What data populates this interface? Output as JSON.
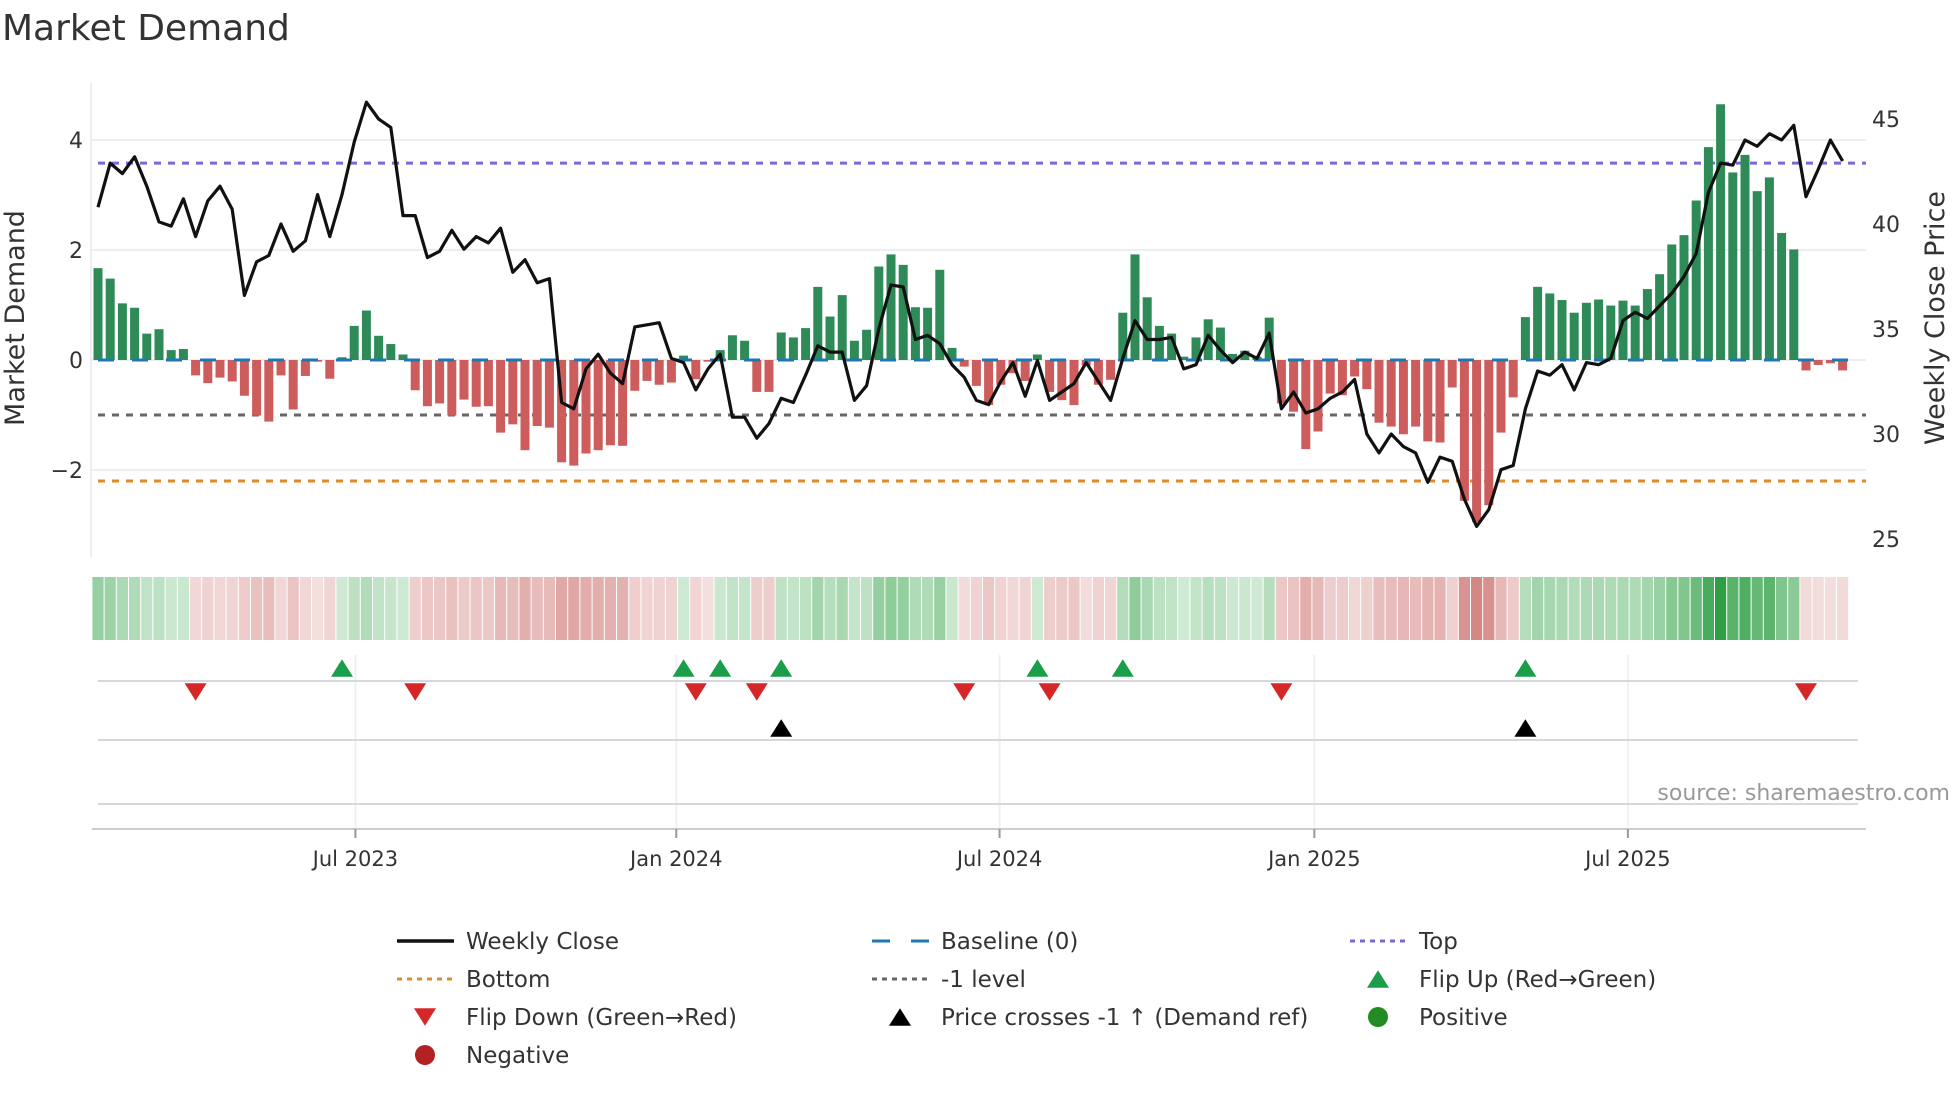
{
  "chart_data": {
    "type": "bar+line",
    "title": "Market Demand",
    "ylabel": "Market Demand",
    "y2label": "Weekly Close Price",
    "ylim": [
      -3.6,
      5.0
    ],
    "y2lim": [
      24.3,
      46.8
    ],
    "yticks": [
      4,
      2,
      0,
      -2
    ],
    "ytick_labels": [
      "4",
      "2",
      "0",
      "−2"
    ],
    "y2ticks": [
      45,
      40,
      35,
      30,
      25
    ],
    "y2tick_labels": [
      "45",
      "40",
      "35",
      "30",
      "25"
    ],
    "xticks": [
      {
        "label": "Jul 2023",
        "week_index": 21.1
      },
      {
        "label": "Jan 2024",
        "week_index": 47.4
      },
      {
        "label": "Jul 2024",
        "week_index": 73.9
      },
      {
        "label": "Jan 2025",
        "week_index": 99.7
      },
      {
        "label": "Jul 2025",
        "week_index": 125.4
      }
    ],
    "levels": {
      "top": 3.58,
      "bottom": -2.2,
      "minus_one": -1.0,
      "baseline": 0
    },
    "demand": [
      1.67,
      1.48,
      1.03,
      0.95,
      0.48,
      0.56,
      0.18,
      0.2,
      -0.28,
      -0.42,
      -0.32,
      -0.39,
      -0.65,
      -1.01,
      -1.12,
      -0.28,
      -0.9,
      -0.29,
      -0.03,
      -0.34,
      0.05,
      0.62,
      0.9,
      0.44,
      0.29,
      0.1,
      -0.55,
      -0.84,
      -0.79,
      -1.01,
      -0.72,
      -0.85,
      -0.84,
      -1.32,
      -1.17,
      -1.64,
      -1.2,
      -1.23,
      -1.86,
      -1.92,
      -1.7,
      -1.64,
      -1.55,
      -1.56,
      -0.56,
      -0.38,
      -0.45,
      -0.41,
      0.08,
      -0.35,
      -0.03,
      0.18,
      0.45,
      0.35,
      -0.58,
      -0.58,
      0.5,
      0.41,
      0.58,
      1.33,
      0.79,
      1.18,
      0.35,
      0.55,
      1.7,
      1.92,
      1.73,
      0.96,
      0.95,
      1.64,
      0.22,
      -0.12,
      -0.47,
      -0.82,
      -0.45,
      -0.24,
      -0.38,
      0.1,
      -0.58,
      -0.73,
      -0.82,
      -0.1,
      -0.45,
      -0.36,
      0.86,
      1.92,
      1.14,
      0.62,
      0.48,
      0.06,
      0.41,
      0.74,
      0.59,
      0.11,
      0.17,
      0.06,
      0.77,
      -0.79,
      -0.94,
      -1.62,
      -1.3,
      -0.61,
      -0.64,
      -0.3,
      -0.53,
      -1.14,
      -1.21,
      -1.35,
      -1.21,
      -1.48,
      -1.5,
      -0.5,
      -2.56,
      -2.95,
      -2.64,
      -1.32,
      -0.68,
      0.78,
      1.33,
      1.21,
      1.09,
      0.86,
      1.04,
      1.1,
      0.99,
      1.08,
      0.99,
      1.29,
      1.56,
      2.1,
      2.27,
      2.9,
      3.87,
      4.65,
      3.41,
      3.73,
      3.07,
      3.32,
      2.31,
      2.01,
      -0.19,
      -0.09,
      -0.06,
      -0.19
    ],
    "weekly_close": [
      40.8,
      42.9,
      42.4,
      43.2,
      41.8,
      40.1,
      39.9,
      41.2,
      39.4,
      41.1,
      41.8,
      40.7,
      36.6,
      38.2,
      38.5,
      40.0,
      38.7,
      39.2,
      41.4,
      39.4,
      41.4,
      43.9,
      45.8,
      45.0,
      44.6,
      40.4,
      40.4,
      38.4,
      38.7,
      39.7,
      38.8,
      39.4,
      39.1,
      39.8,
      37.7,
      38.3,
      37.2,
      37.4,
      31.5,
      31.2,
      33.1,
      33.8,
      32.9,
      32.4,
      35.1,
      35.2,
      35.3,
      33.6,
      33.4,
      32.1,
      33.1,
      33.8,
      30.8,
      30.8,
      29.8,
      30.5,
      31.7,
      31.5,
      32.8,
      34.2,
      33.9,
      33.9,
      31.6,
      32.3,
      35.0,
      37.1,
      37.0,
      34.5,
      34.7,
      34.3,
      33.3,
      32.7,
      31.6,
      31.4,
      32.5,
      33.4,
      31.8,
      33.5,
      31.6,
      32.0,
      32.4,
      33.4,
      32.5,
      31.6,
      33.6,
      35.4,
      34.5,
      34.5,
      34.6,
      33.1,
      33.3,
      34.7,
      34.0,
      33.4,
      33.9,
      33.6,
      34.8,
      31.2,
      32.0,
      31.0,
      31.2,
      31.7,
      32.0,
      32.6,
      30.0,
      29.1,
      30.0,
      29.4,
      29.1,
      27.7,
      28.9,
      28.7,
      26.9,
      25.6,
      26.4,
      28.3,
      28.5,
      31.2,
      33.0,
      32.8,
      33.3,
      32.1,
      33.4,
      33.3,
      33.6,
      35.4,
      35.8,
      35.5,
      36.1,
      36.7,
      37.5,
      38.6,
      41.5,
      42.9,
      42.8,
      44.0,
      43.7,
      44.3,
      44.0,
      44.7,
      41.3,
      42.6,
      44.0,
      43.0
    ],
    "flip_up_indices": [
      20,
      48,
      51,
      56,
      77,
      84,
      117
    ],
    "flip_down_indices": [
      8,
      26,
      49,
      54,
      71,
      78,
      97,
      140
    ],
    "price_cross_indices": [
      56,
      117
    ],
    "legend_placement": "bottom",
    "legend": [
      {
        "label": "Weekly Close",
        "symbol": "line",
        "color": "#111111"
      },
      {
        "label": "Baseline (0)",
        "symbol": "dash",
        "color": "#1f77b4"
      },
      {
        "label": "Top",
        "symbol": "dot",
        "color": "#7b68d9"
      },
      {
        "label": "Bottom",
        "symbol": "dot",
        "color": "#e08a2b"
      },
      {
        "label": "-1 level",
        "symbol": "dot",
        "color": "#666666"
      },
      {
        "label": "Flip Up (Red→Green)",
        "symbol": "tri-up",
        "color": "#1a9e4a"
      },
      {
        "label": "Flip Down (Green→Red)",
        "symbol": "tri-down",
        "color": "#d62728"
      },
      {
        "label": "Price crosses -1 ↑ (Demand ref)",
        "symbol": "tri-up",
        "color": "#000000"
      },
      {
        "label": "Positive",
        "symbol": "circle",
        "color": "#228b22"
      },
      {
        "label": "Negative",
        "symbol": "circle",
        "color": "#b22222"
      }
    ],
    "source": "source: sharemaestro.com"
  },
  "colors": {
    "bar_positive": "#2e8b57",
    "bar_negative": "#cd5c5c",
    "strip_positive": "#2ea043",
    "strip_negative": "#c0504d",
    "grid": "#eceef3",
    "text": "#333333"
  }
}
